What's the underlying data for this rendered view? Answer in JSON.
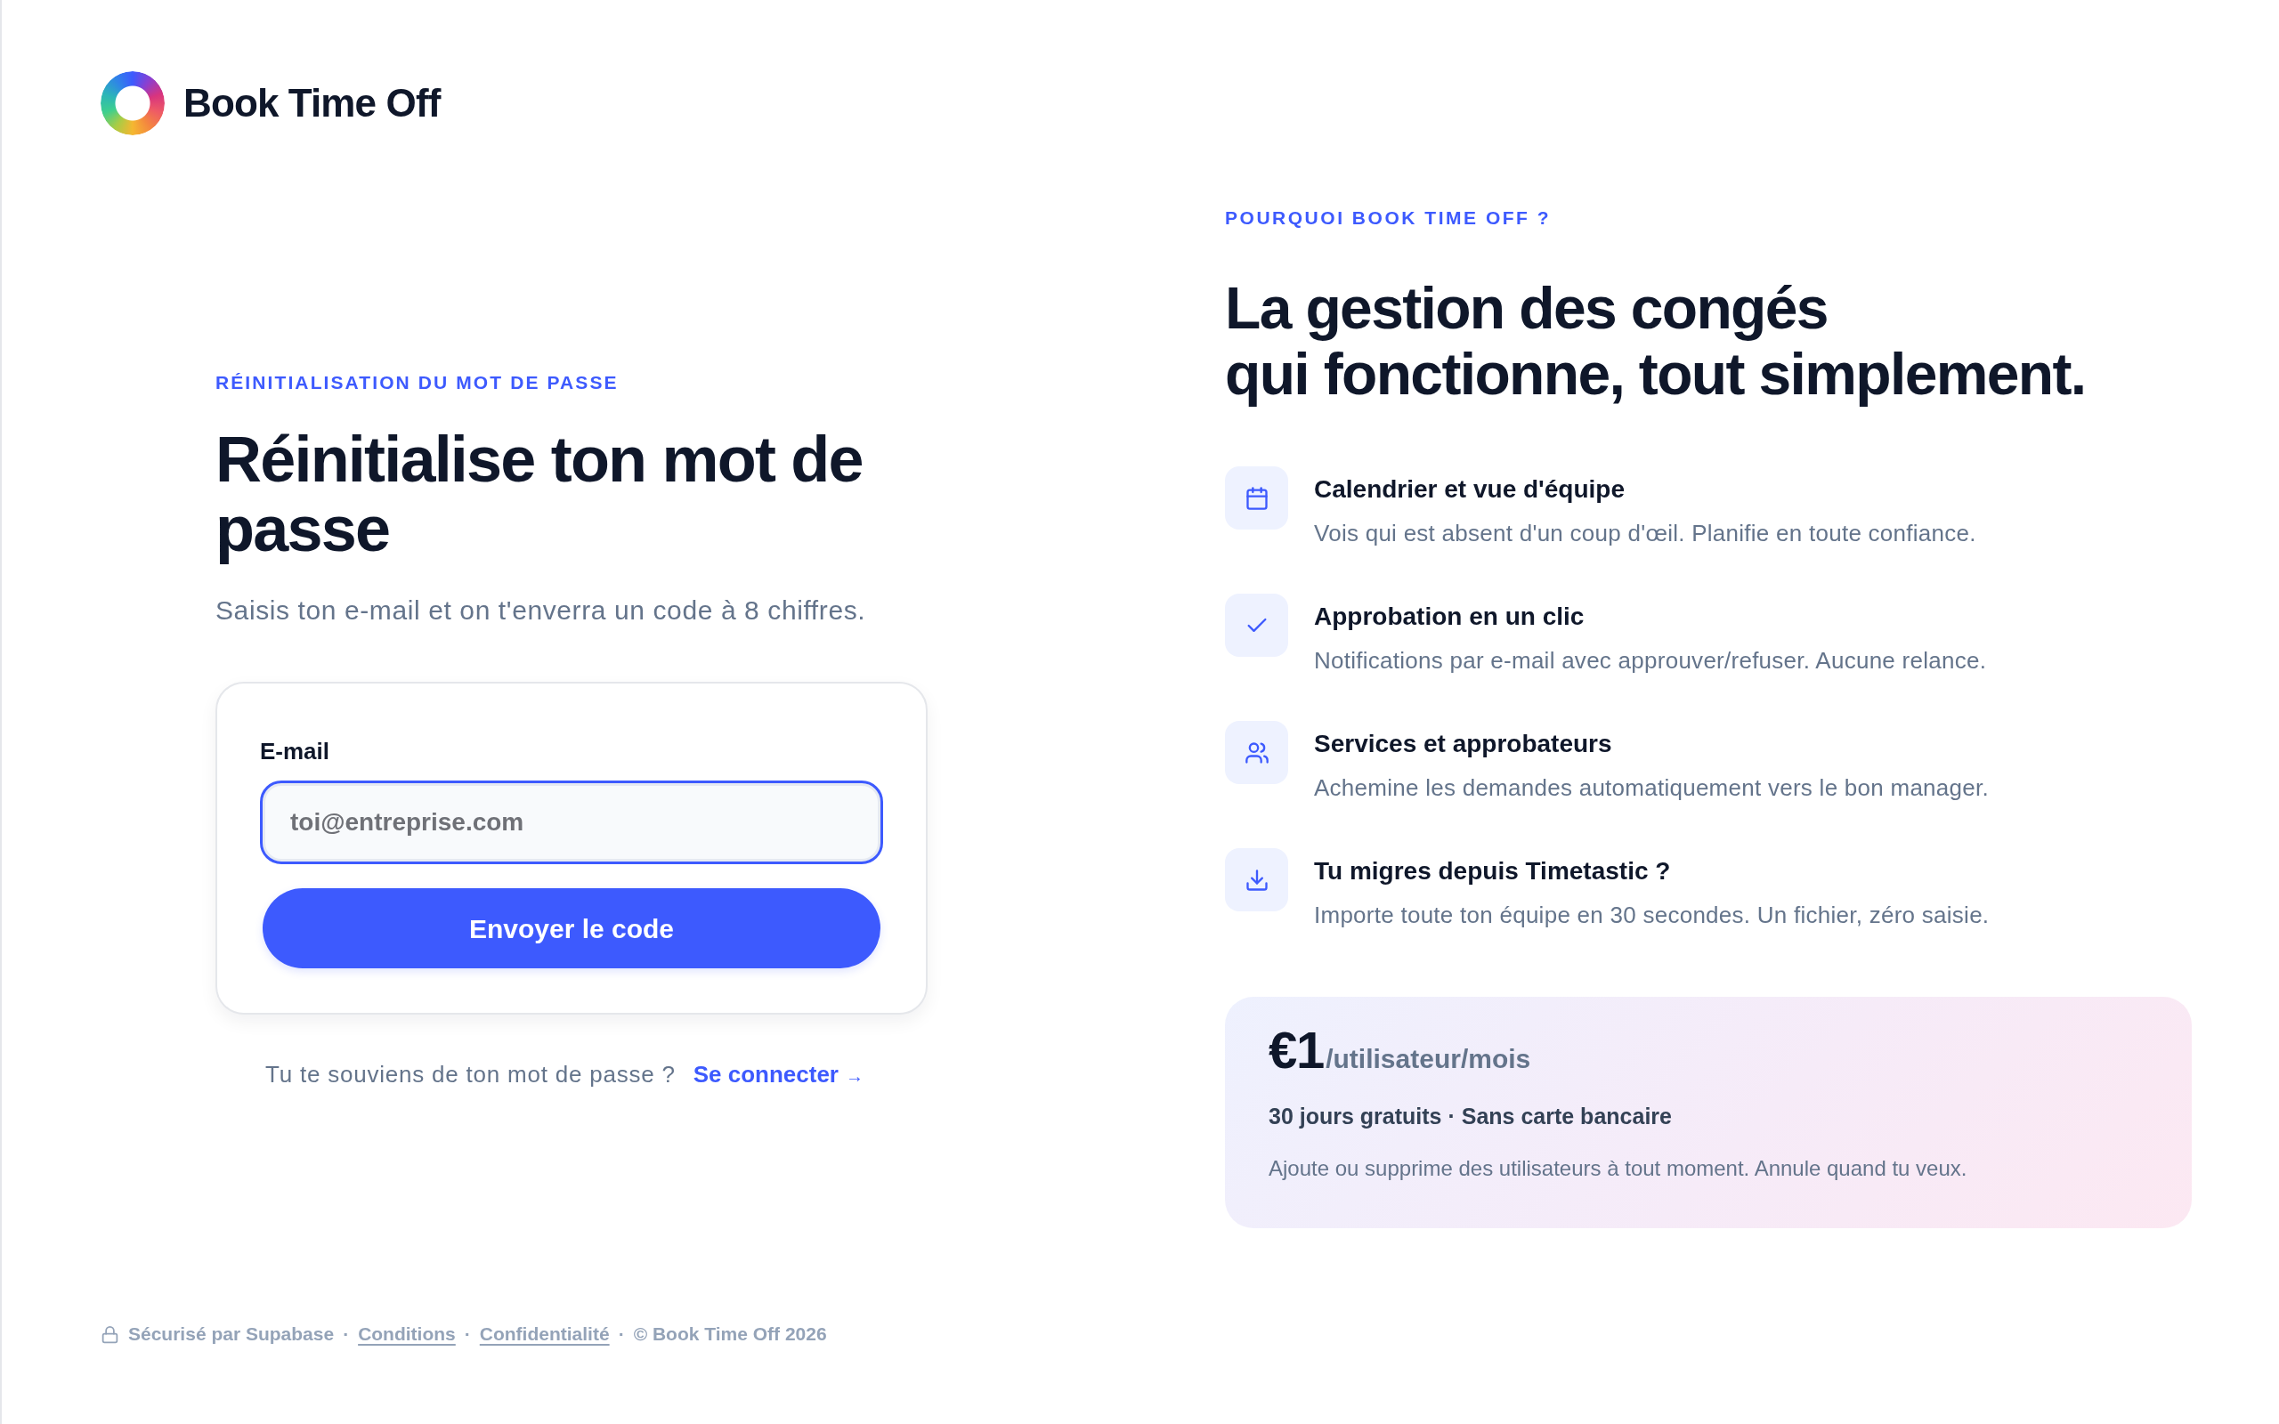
{
  "brand": {
    "name": "Book Time Off"
  },
  "reset": {
    "eyebrow": "RÉINITIALISATION DU MOT DE PASSE",
    "title": "Réinitialise ton mot de passe",
    "subtitle": "Saisis ton e-mail et on t'enverra un code à 8 chiffres.",
    "form": {
      "email_field": {
        "label": "E-mail",
        "placeholder": "toi@entreprise.com",
        "focused": true
      },
      "submit_button": "Envoyer le code"
    },
    "signin_prompt": {
      "text": "Tu te souviens de ton mot de passe ?",
      "link": {
        "label": "Se connecter",
        "arrow": "→"
      }
    }
  },
  "why": {
    "eyebrow": "POURQUOI BOOK TIME OFF ?",
    "title_lines": [
      "La gestion des congés",
      "qui fonctionne, tout simplement."
    ],
    "features": [
      {
        "title": "Calendrier et vue d'équipe",
        "description": "Vois qui est absent d'un coup d'œil. Planifie en toute confiance."
      },
      {
        "title": "Approbation en un clic",
        "description": "Notifications par e-mail avec approuver/refuser. Aucune relance."
      },
      {
        "title": "Services et approbateurs",
        "description": "Achemine les demandes automatiquement vers le bon manager."
      },
      {
        "title": "Tu migres depuis Timetastic ?",
        "description": "Importe toute ton équipe en 30 secondes. Un fichier, zéro saisie."
      }
    ],
    "pricing": {
      "price": "€1",
      "unit": "/utilisateur/mois",
      "highlight": "30 jours gratuits · Sans carte bancaire",
      "note": "Ajoute ou supprime des utilisateurs à tout moment. Annule quand tu veux."
    }
  },
  "footer": {
    "items": [
      {
        "kind": "secure",
        "text": "Sécurisé par Supabase"
      },
      {
        "kind": "separator",
        "text": "·"
      },
      {
        "kind": "link",
        "text": "Conditions"
      },
      {
        "kind": "separator",
        "text": "·"
      },
      {
        "kind": "link",
        "text": "Confidentialité"
      },
      {
        "kind": "separator",
        "text": "·"
      },
      {
        "kind": "text",
        "text": "© Book Time Off 2026"
      }
    ]
  }
}
